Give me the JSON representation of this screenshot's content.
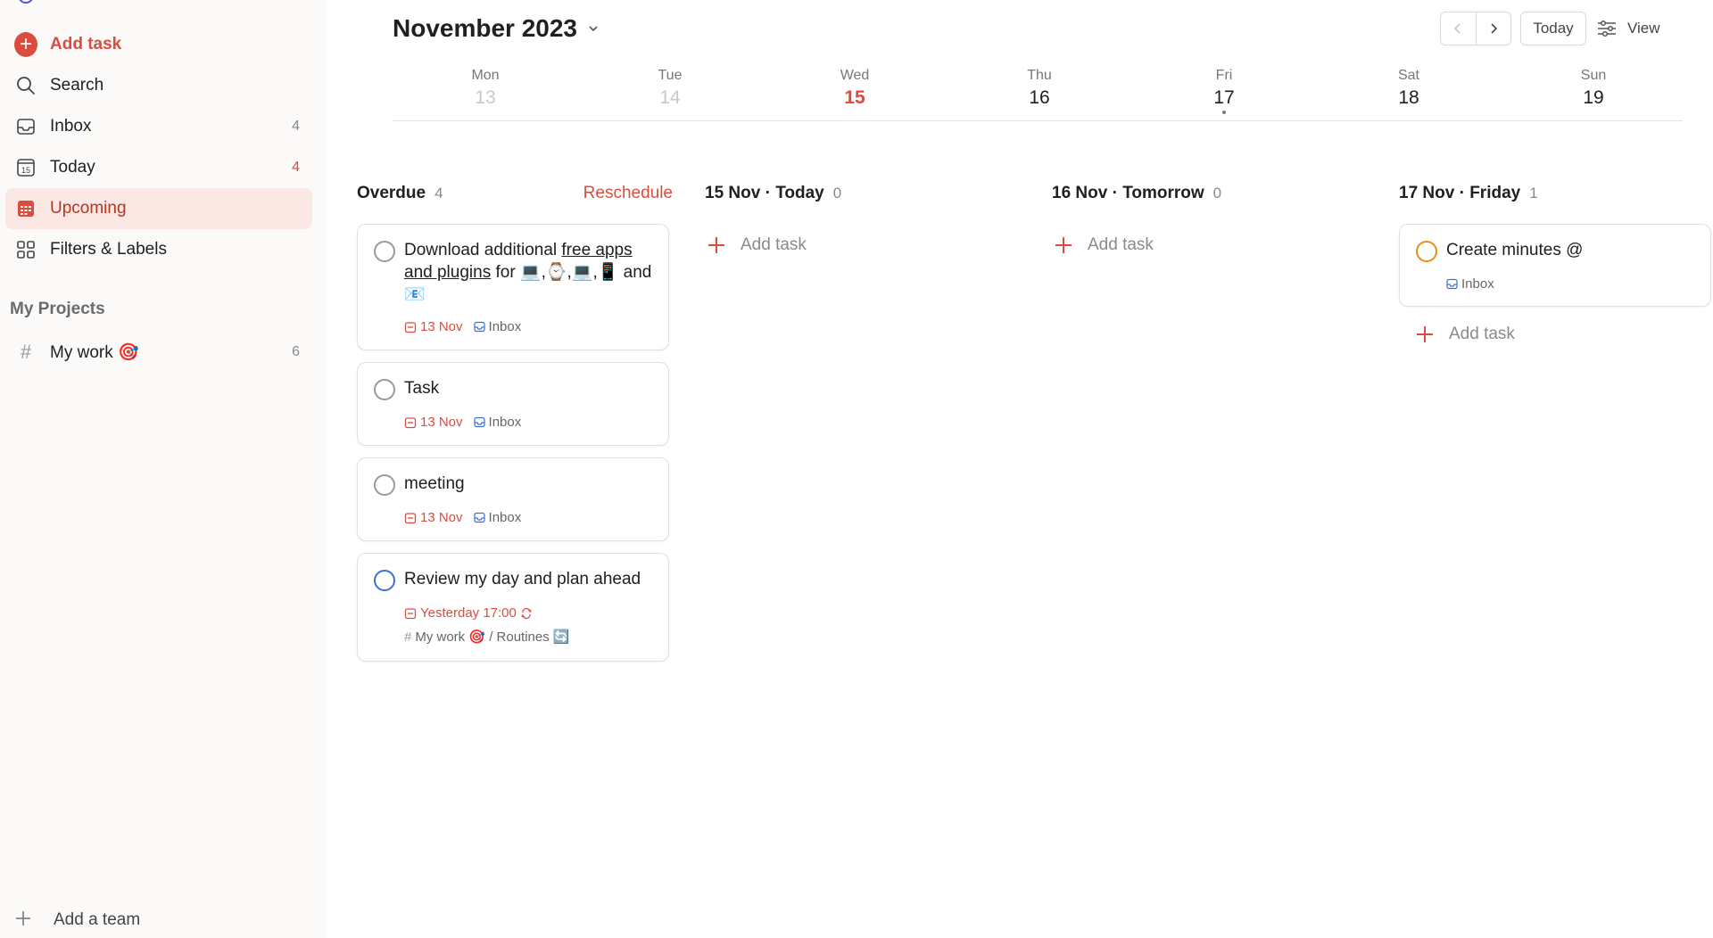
{
  "sidebar": {
    "add_task": "Add task",
    "items": [
      {
        "label": "Search",
        "count": ""
      },
      {
        "label": "Inbox",
        "count": "4"
      },
      {
        "label": "Today",
        "count": "4"
      },
      {
        "label": "Upcoming",
        "count": ""
      },
      {
        "label": "Filters & Labels",
        "count": ""
      }
    ],
    "today_icon_number": "15",
    "projects_header": "My Projects",
    "projects": [
      {
        "label": "My work 🎯",
        "count": "6"
      }
    ],
    "add_team": "Add a team"
  },
  "header": {
    "month": "November 2023",
    "today_button": "Today",
    "view_button": "View"
  },
  "week": [
    {
      "name": "Mon",
      "date": "13"
    },
    {
      "name": "Tue",
      "date": "14"
    },
    {
      "name": "Wed",
      "date": "15"
    },
    {
      "name": "Thu",
      "date": "16"
    },
    {
      "name": "Fri",
      "date": "17"
    },
    {
      "name": "Sat",
      "date": "18"
    },
    {
      "name": "Sun",
      "date": "19"
    }
  ],
  "columns": {
    "overdue": {
      "title": "Overdue",
      "count": "4",
      "reschedule": "Reschedule",
      "tasks": [
        {
          "title_prefix": "Download additional ",
          "title_link": "free apps and plugins",
          "title_suffix": " for 💻,⌚,💻,📱 and 📧",
          "date": "13 Nov",
          "project": "Inbox"
        },
        {
          "title": "Task",
          "date": "13 Nov",
          "project": "Inbox"
        },
        {
          "title": "meeting",
          "date": "13 Nov",
          "project": "Inbox"
        },
        {
          "title": "Review my day and plan ahead",
          "date": "Yesterday 17:00",
          "project": "My work 🎯 / Routines 🔄"
        }
      ]
    },
    "today": {
      "title": "15 Nov · Today",
      "count": "0",
      "add_task": "Add task"
    },
    "tomorrow": {
      "title": "16 Nov · Tomorrow",
      "count": "0",
      "add_task": "Add task"
    },
    "friday": {
      "title": "17 Nov · Friday",
      "count": "1",
      "tasks": [
        {
          "title": "Create minutes @",
          "project": "Inbox"
        }
      ],
      "add_task": "Add task"
    }
  },
  "colors": {
    "accent": "#dc4c3e",
    "sidebar_bg": "#fcfaf8",
    "active_bg": "#fbe7e3",
    "blue": "#3e6fd8",
    "orange": "#eb8d13"
  }
}
